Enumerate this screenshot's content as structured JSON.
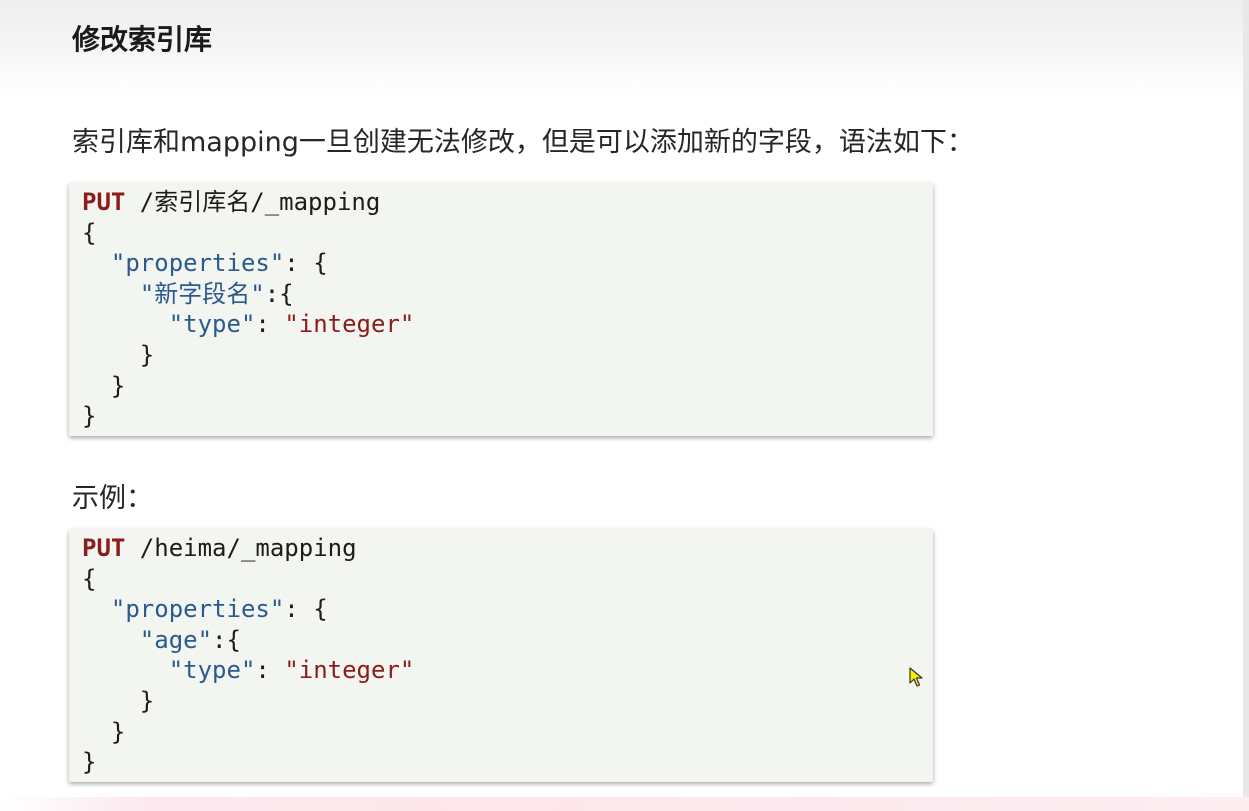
{
  "heading": "修改索引库",
  "intro": "索引库和mapping一旦创建无法修改，但是可以添加新的字段，语法如下：",
  "syntax_block": {
    "method": "PUT",
    "path": " /索引库名/_mapping",
    "open_brace": "{",
    "props_key": "\"properties\"",
    "props_sep": ": {",
    "field_key": "\"新字段名\"",
    "field_sep": ":{",
    "type_key": "\"type\"",
    "type_sep": ": ",
    "type_val": "\"integer\"",
    "close_inner": "}",
    "close_props": "}",
    "close_root": "}"
  },
  "example_label": "示例：",
  "example_block": {
    "method": "PUT",
    "path": " /heima/_mapping",
    "open_brace": "{",
    "props_key": "\"properties\"",
    "props_sep": ": {",
    "field_key": "\"age\"",
    "field_sep": ":{",
    "type_key": "\"type\"",
    "type_sep": ": ",
    "type_val": "\"integer\"",
    "close_inner": "}",
    "close_props": "}",
    "close_root": "}"
  },
  "colors": {
    "keyword": "#8b1c1c",
    "json_key": "#2a5a8f",
    "string_value": "#8b1c1c",
    "code_background": "#f3f5f0"
  },
  "icons": {
    "cursor": "mouse-pointer-icon"
  }
}
